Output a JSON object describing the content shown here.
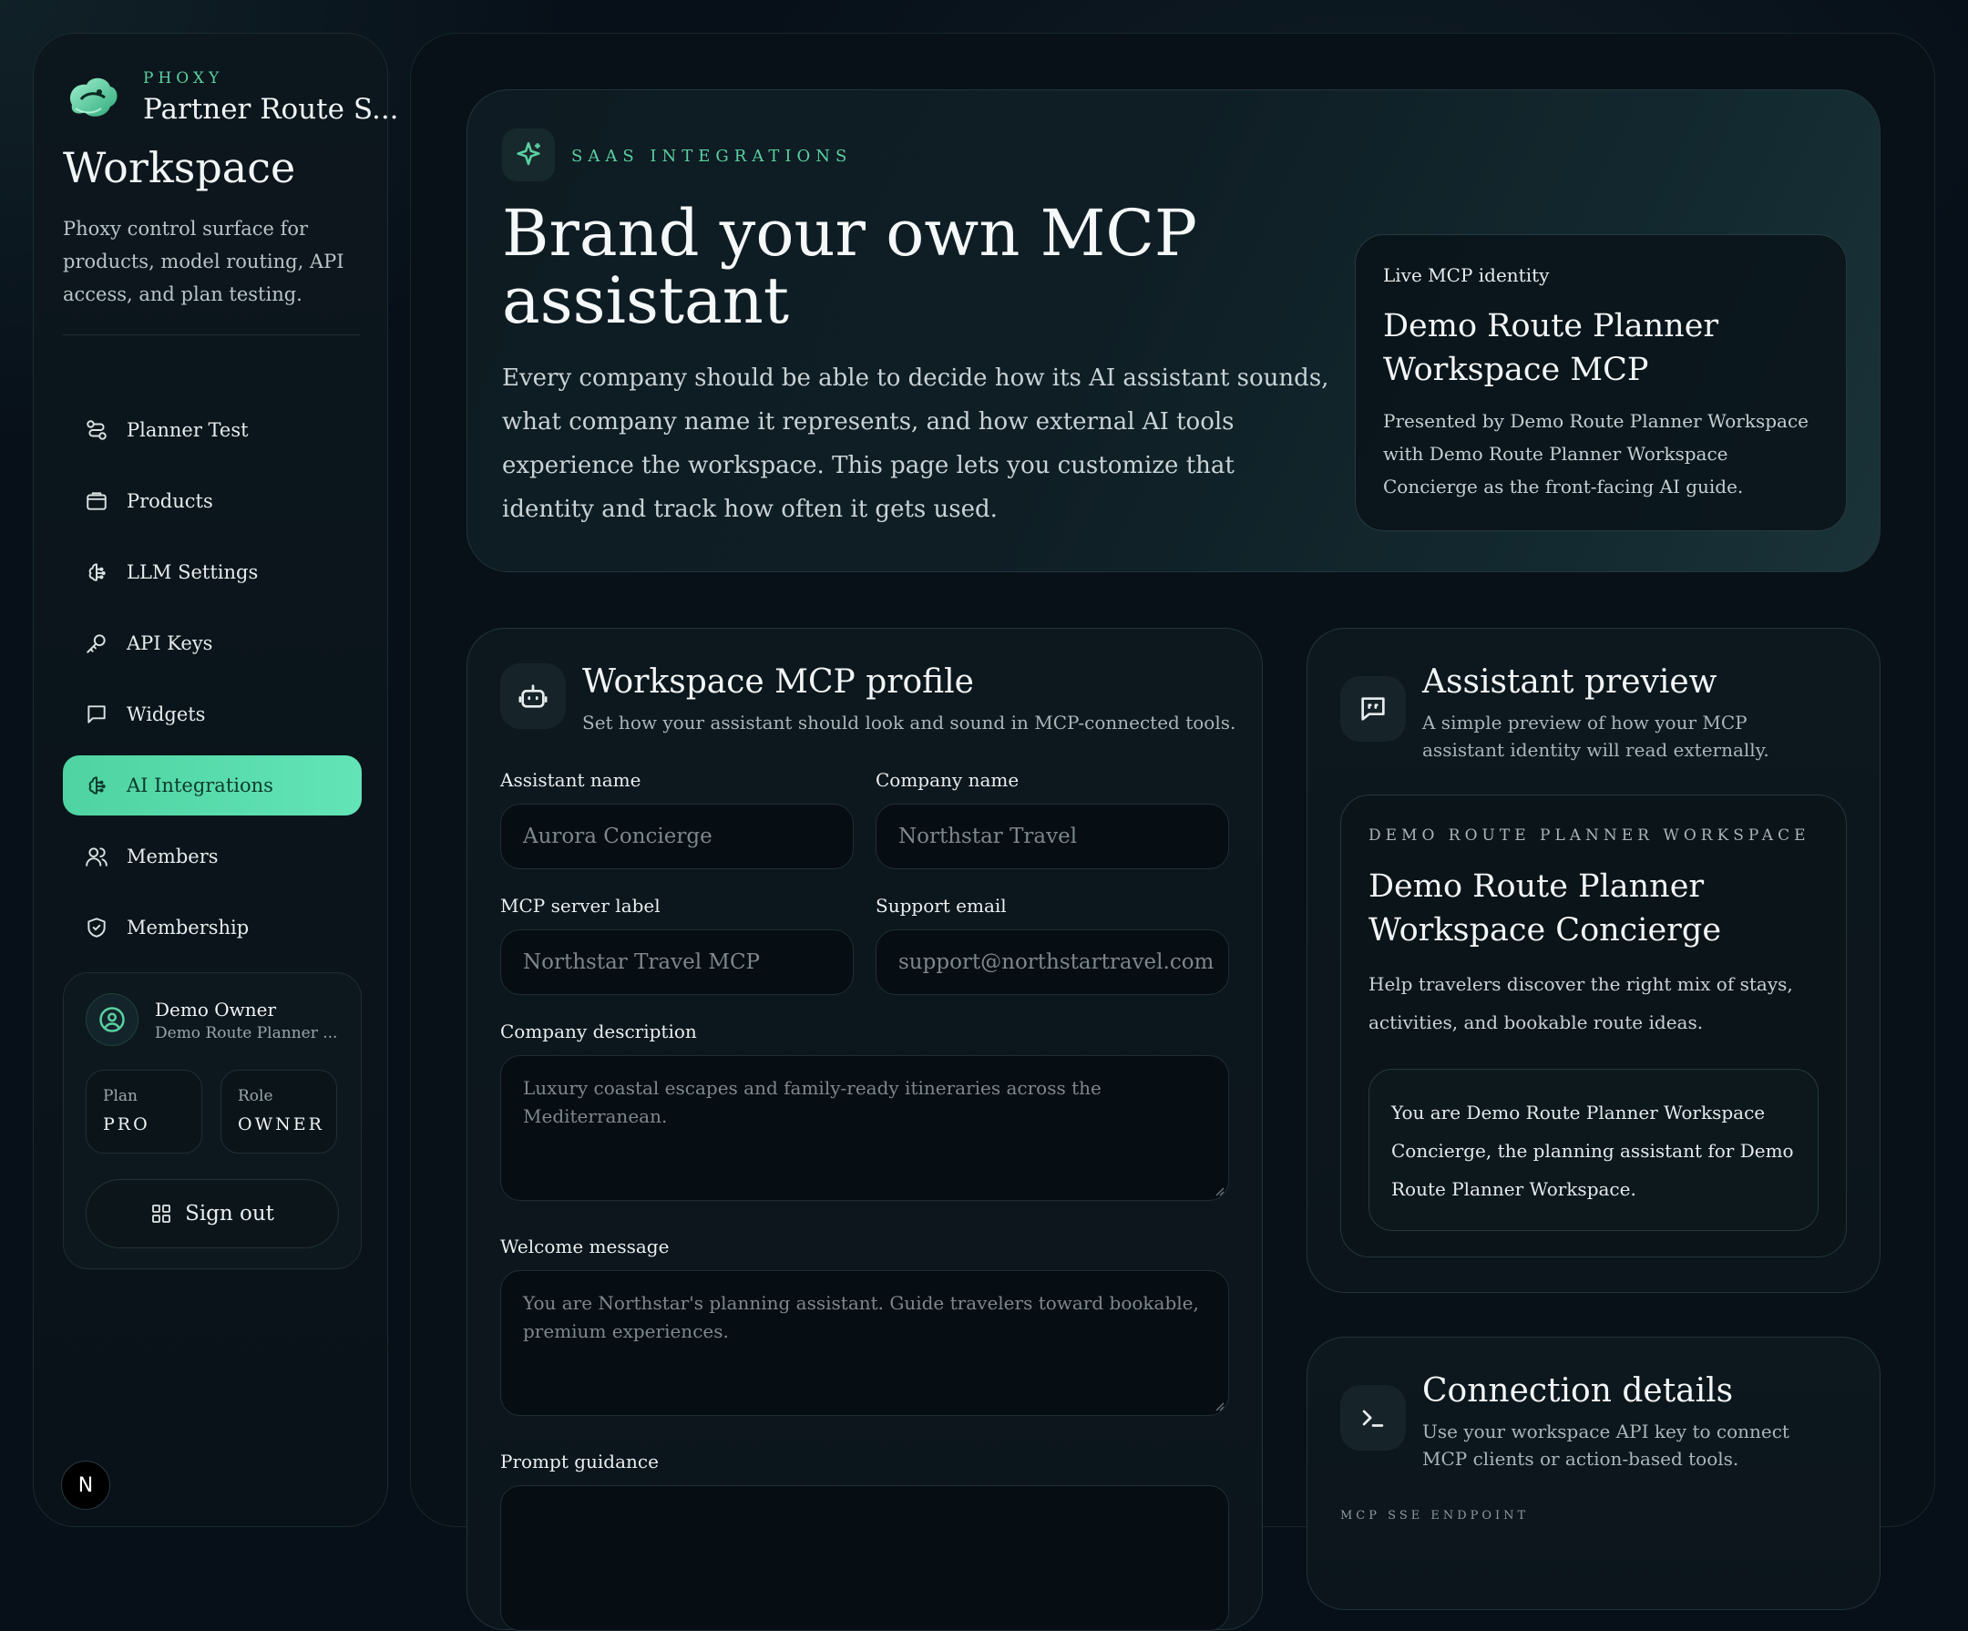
{
  "sidebar": {
    "brand_kicker": "PHOXY",
    "brand_name": "Partner Route S...",
    "title": "Workspace",
    "description": "Phoxy control surface for products, model routing, API access, and plan testing.",
    "nav": [
      {
        "label": "Planner Test",
        "icon": "route-icon"
      },
      {
        "label": "Products",
        "icon": "package-icon"
      },
      {
        "label": "LLM Settings",
        "icon": "brain-icon"
      },
      {
        "label": "API Keys",
        "icon": "key-icon"
      },
      {
        "label": "Widgets",
        "icon": "message-square-icon"
      },
      {
        "label": "AI Integrations",
        "icon": "brain-icon",
        "active": true
      },
      {
        "label": "Members",
        "icon": "users-icon"
      },
      {
        "label": "Membership",
        "icon": "shield-icon"
      }
    ],
    "user": {
      "name": "Demo Owner",
      "workspace": "Demo Route Planner ...",
      "plan_label": "Plan",
      "plan_value": "PRO",
      "role_label": "Role",
      "role_value": "OWNER",
      "signout_label": "Sign out"
    },
    "badge": "N"
  },
  "hero": {
    "kicker": "SAAS INTEGRATIONS",
    "title": "Brand your own MCP assistant",
    "description": "Every company should be able to decide how its AI assistant sounds, what company name it represents, and how external AI tools experience the workspace. This page lets you customize that identity and track how often it gets used.",
    "identity": {
      "label": "Live MCP identity",
      "name": "Demo Route Planner Workspace MCP",
      "description": "Presented by Demo Route Planner Workspace with Demo Route Planner Workspace Concierge as the front-facing AI guide."
    }
  },
  "profile": {
    "title": "Workspace MCP profile",
    "subtitle": "Set how your assistant should look and sound in MCP-connected tools.",
    "fields": {
      "assistant_name": {
        "label": "Assistant name",
        "placeholder": "Aurora Concierge"
      },
      "company_name": {
        "label": "Company name",
        "placeholder": "Northstar Travel"
      },
      "server_label": {
        "label": "MCP server label",
        "placeholder": "Northstar Travel MCP"
      },
      "support_email": {
        "label": "Support email",
        "placeholder": "support@northstartravel.com"
      },
      "company_description": {
        "label": "Company description",
        "placeholder": "Luxury coastal escapes and family-ready itineraries across the Mediterranean."
      },
      "welcome_message": {
        "label": "Welcome message",
        "placeholder": "You are Northstar's planning assistant. Guide travelers toward bookable, premium experiences."
      },
      "prompt_guidance": {
        "label": "Prompt guidance"
      }
    }
  },
  "preview": {
    "title": "Assistant preview",
    "subtitle": "A simple preview of how your MCP assistant identity will read externally.",
    "workspace_kicker": "DEMO ROUTE PLANNER WORKSPACE",
    "assistant_name": "Demo Route Planner Workspace Concierge",
    "description": "Help travelers discover the right mix of stays, activities, and bookable route ideas.",
    "prompt": "You are Demo Route Planner Workspace Concierge, the planning assistant for Demo Route Planner Workspace."
  },
  "connection": {
    "title": "Connection details",
    "subtitle": "Use your workspace API key to connect MCP clients or action-based tools.",
    "endpoint_label": "MCP SSE ENDPOINT"
  },
  "colors": {
    "accent": "#5ad0a0",
    "active_nav": "#5fdcae",
    "background": "#071019"
  }
}
